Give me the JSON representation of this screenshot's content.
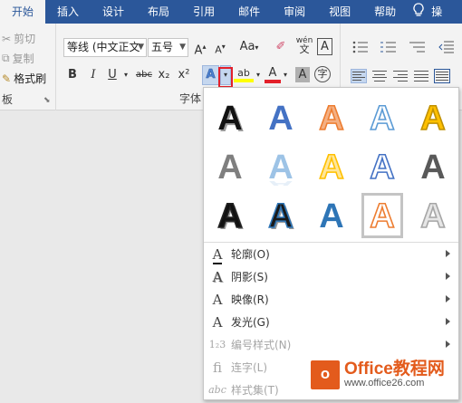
{
  "tabs": [
    {
      "label": "开始",
      "active": true
    },
    {
      "label": "插入"
    },
    {
      "label": "设计"
    },
    {
      "label": "布局"
    },
    {
      "label": "引用"
    },
    {
      "label": "邮件"
    },
    {
      "label": "审阅"
    },
    {
      "label": "视图"
    },
    {
      "label": "帮助"
    },
    {
      "label": "操"
    }
  ],
  "clipboard": {
    "cut": "剪切",
    "copy": "复制",
    "format_painter": "格式刷",
    "group_label": "板"
  },
  "font": {
    "family": "等线 (中文正文",
    "size": "五号",
    "grow": "A",
    "shrink": "A",
    "case": "Aa",
    "phonetic": "wén",
    "border_char": "A",
    "bold": "B",
    "italic": "I",
    "underline": "U",
    "strike": "abc",
    "subscript": "x₂",
    "superscript": "x²",
    "effects": "A",
    "highlight": "ab",
    "font_color": "A",
    "shade_char": "A",
    "enclose_char": "字",
    "group_label": "字体"
  },
  "text_effects_menu": {
    "gallery": [
      {
        "style": "shadow-black",
        "fill": "#111111",
        "stroke": "none"
      },
      {
        "style": "blue",
        "fill": "#4472c4",
        "stroke": "none"
      },
      {
        "style": "orange-outline",
        "fill": "#f4b083",
        "stroke": "#ed7d31"
      },
      {
        "style": "lightblue-outline",
        "fill": "#ffffff",
        "stroke": "#5b9bd5"
      },
      {
        "style": "gold",
        "fill": "#ffc000",
        "stroke": "#bf9000"
      },
      {
        "style": "gray",
        "fill": "#7f7f7f",
        "stroke": "none"
      },
      {
        "style": "lightblue-reflection",
        "fill": "#9dc3e6",
        "stroke": "none"
      },
      {
        "style": "yellow-outline",
        "fill": "#ffe699",
        "stroke": "#ffc000"
      },
      {
        "style": "white-blue-outline",
        "fill": "#ffffff",
        "stroke": "#4472c4"
      },
      {
        "style": "dark-gray",
        "fill": "#595959",
        "stroke": "none"
      },
      {
        "style": "black-outline-shadow",
        "fill": "#111111",
        "stroke": "#222222"
      },
      {
        "style": "black-blue-shadow",
        "fill": "#1a1a1a",
        "stroke": "#2e75b6"
      },
      {
        "style": "blue-gradient",
        "fill": "#2e75b6",
        "stroke": "none"
      },
      {
        "style": "orange-outline-selected",
        "fill": "#ffffff",
        "stroke": "#ed7d31",
        "selected": true
      },
      {
        "style": "silver",
        "fill": "#e6e6e6",
        "stroke": "#a6a6a6"
      }
    ],
    "items": [
      {
        "label": "轮廓(O)",
        "icon": "outline-icon",
        "enabled": true,
        "submenu": true
      },
      {
        "label": "阴影(S)",
        "icon": "shadow-icon",
        "enabled": true,
        "submenu": true
      },
      {
        "label": "映像(R)",
        "icon": "reflection-icon",
        "enabled": true,
        "submenu": true
      },
      {
        "label": "发光(G)",
        "icon": "glow-icon",
        "enabled": true,
        "submenu": true
      },
      {
        "label": "编号样式(N)",
        "icon": "number-style-icon",
        "enabled": false,
        "submenu": true
      },
      {
        "label": "连字(L)",
        "icon": "ligature-icon",
        "enabled": false,
        "submenu": true
      },
      {
        "label": "样式集(T)",
        "icon": "stylistic-set-icon",
        "enabled": false,
        "submenu": true
      }
    ]
  },
  "watermark": {
    "logo": "O",
    "title": "Office教程网",
    "url": "www.office26.com"
  },
  "colors": {
    "ribbon_blue": "#2b579a",
    "highlight_red": "#e3202a",
    "watermark_orange": "#e35b1c"
  }
}
